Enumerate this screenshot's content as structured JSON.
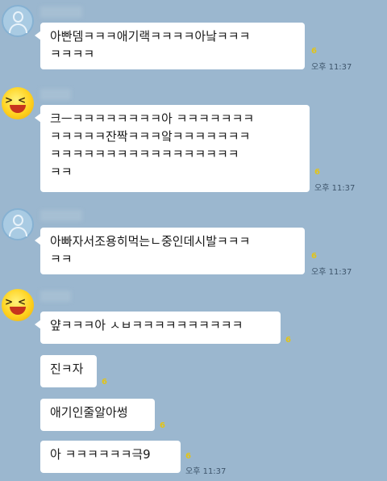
{
  "messages": [
    {
      "sender": "blurred",
      "text": "아빤뎀ㅋㅋㅋ애기랙ㅋㅋㅋㅋ아낰ㅋㅋㅋ\nㅋㅋㅋㅋ",
      "unread": "6",
      "time": "오후 11:37"
    },
    {
      "sender": "blurred",
      "text": "크ㅡㅋㅋㅋㅋㅋㅋㅋㅋ아 ㅋㅋㅋㅋㅋㅋㅋ\nㅋㅋㅋㅋㅋ잔짝ㅋㅋㅋ앜ㅋㅋㅋㅋㅋㅋㅋ\nㅋㅋㅋㅋㅋㅋㅋㅋㅋㅋㅋㅋㅋㅋㅋㅋㅋ\nㅋㅋ",
      "unread": "6",
      "time": "오후 11:37"
    },
    {
      "sender": "blurred",
      "text": "아빠자서조용히먹는ㄴ중인데시발ㅋㅋㅋ\nㅋㅋ",
      "unread": "6",
      "time": "오후 11:37"
    },
    {
      "sender": "blurred",
      "text": "얖ㅋㅋㅋ아 ㅅㅂㅋㅋㅋㅋㅋㅋㅋㅋㅋㅋ",
      "unread": "6"
    },
    {
      "text": "진ㅋ자",
      "unread": "6"
    },
    {
      "text": "애기인줄알아썽",
      "unread": "6"
    },
    {
      "text": "아 ㅋㅋㅋㅋㅋㅋ극9",
      "unread": "6",
      "time": "오후 11:37"
    }
  ]
}
